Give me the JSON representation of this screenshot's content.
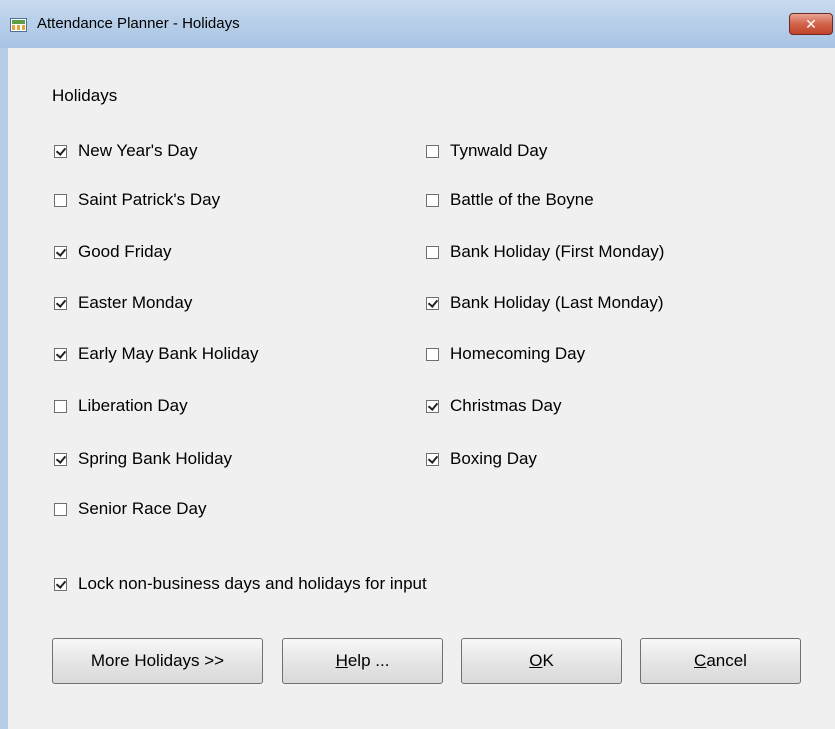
{
  "window": {
    "title": "Attendance Planner - Holidays",
    "close_glyph": "✕"
  },
  "group_label": "Holidays",
  "holidays_left": [
    {
      "label": "New Year's Day",
      "checked": true
    },
    {
      "label": "Saint Patrick's Day",
      "checked": false
    },
    {
      "label": "Good Friday",
      "checked": true
    },
    {
      "label": "Easter Monday",
      "checked": true
    },
    {
      "label": "Early May Bank Holiday",
      "checked": true
    },
    {
      "label": "Liberation Day",
      "checked": false
    },
    {
      "label": "Spring Bank Holiday",
      "checked": true
    },
    {
      "label": "Senior Race Day",
      "checked": false
    }
  ],
  "holidays_right": [
    {
      "label": "Tynwald Day",
      "checked": false
    },
    {
      "label": "Battle of the Boyne",
      "checked": false
    },
    {
      "label": "Bank Holiday (First Monday)",
      "checked": false
    },
    {
      "label": "Bank Holiday (Last Monday)",
      "checked": true
    },
    {
      "label": "Homecoming Day",
      "checked": false
    },
    {
      "label": "Christmas Day",
      "checked": true
    },
    {
      "label": "Boxing Day",
      "checked": true
    }
  ],
  "lock_option": {
    "label": "Lock non-business days and holidays for input",
    "checked": true
  },
  "buttons": {
    "more_holidays": "More Holidays >>",
    "help_mnemonic": "H",
    "help_rest": "elp ...",
    "ok_mnemonic": "O",
    "ok_rest": "K",
    "cancel_mnemonic": "C",
    "cancel_rest": "ancel"
  },
  "colors": {
    "titlebar": "#b8cfe9",
    "close_button": "#c1432a",
    "dialog_background": "#f0f0f0"
  }
}
